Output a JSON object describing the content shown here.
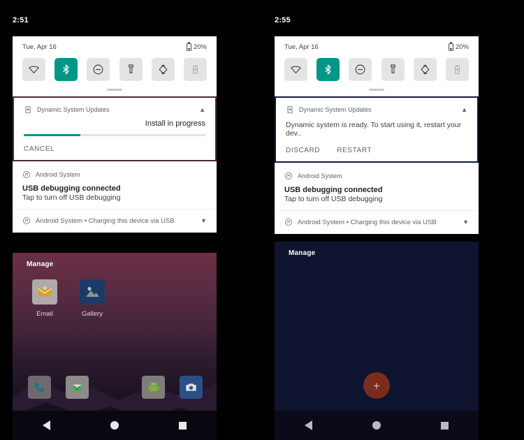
{
  "left": {
    "status": {
      "clock": "2:51"
    },
    "quick_settings": {
      "date": "Tue, Apr 16",
      "battery": "20%",
      "tiles": [
        {
          "name": "wifi-tile",
          "icon": "wifi-icon",
          "state": "off"
        },
        {
          "name": "bluetooth-tile",
          "icon": "bluetooth-icon",
          "state": "on"
        },
        {
          "name": "do-not-disturb-tile",
          "icon": "do-not-disturb-icon",
          "state": "off"
        },
        {
          "name": "flashlight-tile",
          "icon": "flashlight-icon",
          "state": "off"
        },
        {
          "name": "auto-rotate-tile",
          "icon": "auto-rotate-icon",
          "state": "off"
        },
        {
          "name": "battery-saver-tile",
          "icon": "battery-saver-icon",
          "state": "disabled"
        }
      ]
    },
    "notifications": [
      {
        "app": "Dynamic System Updates",
        "icon": "system-update-icon",
        "status": "Install in progress",
        "progress_percent": 31,
        "actions": [
          "CANCEL"
        ],
        "collapse": "chevron-up-icon",
        "highlighted": true
      },
      {
        "app": "Android System",
        "icon": "android-system-icon",
        "title": "USB debugging connected",
        "body": "Tap to turn off USB debugging"
      },
      {
        "app": "Android System • Charging this device via USB",
        "icon": "android-system-icon",
        "collapse": "chevron-down-icon"
      }
    ],
    "home": {
      "manage_label": "Manage",
      "apps": [
        {
          "label": "Email",
          "icon": "email-icon"
        },
        {
          "label": "Gallery",
          "icon": "gallery-icon"
        }
      ],
      "dock": [
        {
          "name": "phone-dock-icon"
        },
        {
          "name": "messaging-dock-icon"
        },
        {
          "name": "android-dock-icon"
        },
        {
          "name": "camera-dock-icon"
        }
      ]
    },
    "navigation": [
      "back-button",
      "home-button",
      "recents-button"
    ]
  },
  "right": {
    "status": {
      "clock": "2:55"
    },
    "quick_settings": {
      "date": "Tue, Apr 16",
      "battery": "20%",
      "tiles": [
        {
          "name": "wifi-tile",
          "icon": "wifi-icon",
          "state": "off"
        },
        {
          "name": "bluetooth-tile",
          "icon": "bluetooth-icon",
          "state": "on"
        },
        {
          "name": "do-not-disturb-tile",
          "icon": "do-not-disturb-icon",
          "state": "off"
        },
        {
          "name": "flashlight-tile",
          "icon": "flashlight-icon",
          "state": "off"
        },
        {
          "name": "auto-rotate-tile",
          "icon": "auto-rotate-icon",
          "state": "off"
        },
        {
          "name": "battery-saver-tile",
          "icon": "battery-saver-icon",
          "state": "disabled"
        }
      ]
    },
    "notifications": [
      {
        "app": "Dynamic System Updates",
        "icon": "system-update-icon",
        "body": "Dynamic system is ready. To start using it, restart your dev..",
        "actions": [
          "DISCARD",
          "RESTART"
        ],
        "collapse": "chevron-up-icon",
        "highlighted": true
      },
      {
        "app": "Android System",
        "icon": "android-system-icon",
        "title": "USB debugging connected",
        "body": "Tap to turn off USB debugging"
      },
      {
        "app": "Android System • Charging this device via USB",
        "icon": "android-system-icon",
        "collapse": "chevron-down-icon"
      }
    ],
    "home": {
      "manage_label": "Manage",
      "fab_label": "+"
    },
    "navigation": [
      "back-button",
      "home-button",
      "recents-button"
    ]
  },
  "colors": {
    "accent_teal": "#009688",
    "highlight_left": "#4c2a33",
    "highlight_right": "#121a3a",
    "fab": "#7a2d1c",
    "panel_bg": "#ffffff"
  }
}
